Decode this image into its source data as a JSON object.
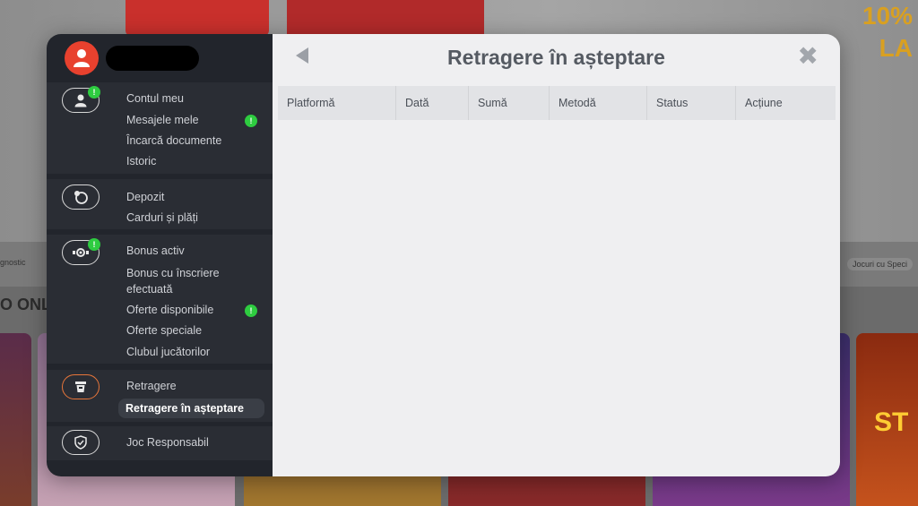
{
  "background": {
    "promo_text": "10%\nLA",
    "online_text": "O ONL",
    "strip_left": "gnostic",
    "strip_right": "Jocuri cu Speci",
    "tile_text": "ST"
  },
  "sidebar": {
    "sections": [
      {
        "icon": "user-icon",
        "badge": "!",
        "items": [
          {
            "label": "Contul meu"
          },
          {
            "label": "Mesajele mele",
            "badge": "!"
          },
          {
            "label": "Încarcă documente"
          },
          {
            "label": "Istoric"
          }
        ]
      },
      {
        "icon": "deposit-icon",
        "items": [
          {
            "label": "Depozit"
          },
          {
            "label": "Carduri și plăți"
          }
        ]
      },
      {
        "icon": "bonus-icon",
        "badge": "!",
        "items": [
          {
            "label": "Bonus activ"
          },
          {
            "label": "Bonus cu înscriere"
          },
          {
            "label": "efectuată"
          },
          {
            "label": "Oferte disponibile",
            "badge": "!"
          },
          {
            "label": "Oferte speciale"
          },
          {
            "label": "Clubul jucătorilor"
          }
        ]
      },
      {
        "icon": "withdraw-icon",
        "items": [
          {
            "label": "Retragere"
          },
          {
            "label": "Retragere în așteptare"
          }
        ]
      },
      {
        "icon": "shield-check-icon",
        "items": [
          {
            "label": "Joc Responsabil"
          }
        ]
      }
    ]
  },
  "content": {
    "title": "Retragere în așteptare",
    "back_icon": "back-arrow-icon",
    "close_icon": "close-icon",
    "close_glyph": "✖",
    "table": {
      "columns": [
        "Platformă",
        "Dată",
        "Sumă",
        "Metodă",
        "Status",
        "Acțiune"
      ]
    }
  },
  "colors": {
    "accent": "#e8412e",
    "active_ring": "#e8763a",
    "badge": "#2ecc40",
    "sidebar_bg": "#22252c",
    "content_bg": "#efeff1"
  }
}
